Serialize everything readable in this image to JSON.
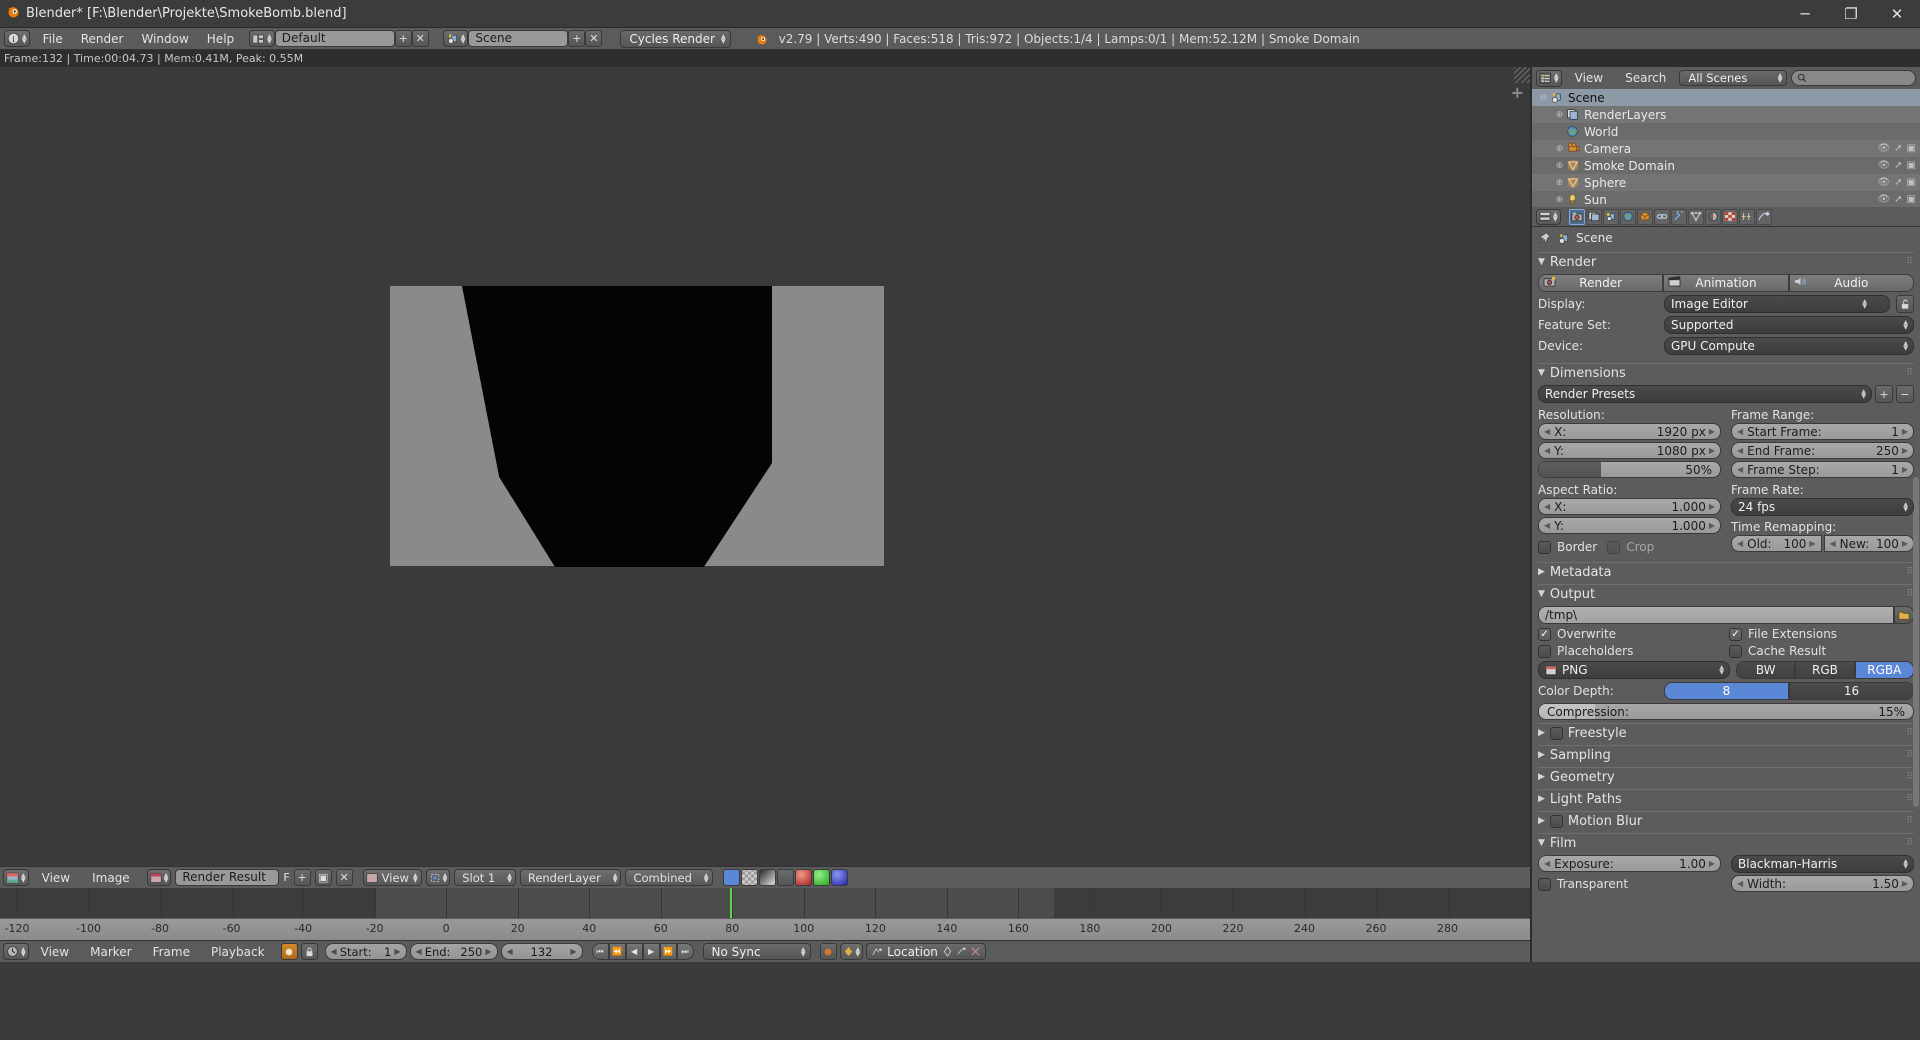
{
  "window": {
    "title": "Blender* [F:\\Blender\\Projekte\\SmokeBomb.blend]",
    "minimize": "─",
    "maximize": "❐",
    "close": "✕"
  },
  "topbar": {
    "menus": [
      "File",
      "Render",
      "Window",
      "Help"
    ],
    "screen_layout": "Default",
    "scene_name": "Scene",
    "engine": "Cycles Render",
    "add_label": "+",
    "remove_label": "✕",
    "stats": "v2.79 | Verts:490 | Faces:518 | Tris:972 | Objects:1/4 | Lamps:0/1 | Mem:52.12M | Smoke Domain"
  },
  "infostrip": {
    "text": "Frame:132 | Time:00:04.73 | Mem:0.41M, Peak: 0.55M"
  },
  "outliner": {
    "header": {
      "view": "View",
      "search": "Search",
      "scene_filter": "All Scenes",
      "search_placeholder": ""
    },
    "rows": [
      {
        "label": "Scene",
        "indent": 0,
        "icon": "scene-icon",
        "expander": "⊖",
        "selected": true
      },
      {
        "label": "RenderLayers",
        "indent": 1,
        "icon": "renderlayers-icon",
        "expander": "⊕",
        "selected": false
      },
      {
        "label": "World",
        "indent": 1,
        "icon": "world-icon",
        "expander": "",
        "selected": false
      },
      {
        "label": "Camera",
        "indent": 1,
        "icon": "camera-icon",
        "expander": "⊕",
        "selected": false
      },
      {
        "label": "Smoke Domain",
        "indent": 1,
        "icon": "mesh-icon",
        "expander": "⊕",
        "selected": false
      },
      {
        "label": "Sphere",
        "indent": 1,
        "icon": "mesh-icon",
        "expander": "⊕",
        "selected": false
      },
      {
        "label": "Sun",
        "indent": 1,
        "icon": "lamp-icon",
        "expander": "⊕",
        "selected": false
      }
    ]
  },
  "properties": {
    "tabs": [
      "render-tab",
      "renderlayers-tab",
      "scene-tab",
      "world-tab",
      "object-tab",
      "constraints-tab",
      "modifiers-tab",
      "data-tab",
      "material-tab",
      "texture-tab",
      "particles-tab",
      "physics-tab"
    ],
    "active_tab_index": 0,
    "breadcrumb": "Scene",
    "render_panel": {
      "title": "Render",
      "buttons": [
        "Render",
        "Animation",
        "Audio"
      ],
      "display_label": "Display:",
      "display_value": "Image Editor",
      "feature_set_label": "Feature Set:",
      "feature_set_value": "Supported",
      "device_label": "Device:",
      "device_value": "GPU Compute"
    },
    "dimensions_panel": {
      "title": "Dimensions",
      "presets": "Render Presets",
      "resolution_label": "Resolution:",
      "res_x_label": "X:",
      "res_x_value": "1920 px",
      "res_y_label": "Y:",
      "res_y_value": "1080 px",
      "res_percent": "50%",
      "res_percent_fill": 34,
      "aspect_label": "Aspect Ratio:",
      "aspect_x_label": "X:",
      "aspect_x_value": "1.000",
      "aspect_y_label": "Y:",
      "aspect_y_value": "1.000",
      "border_label": "Border",
      "border_checked": false,
      "crop_label": "Crop",
      "crop_checked": false,
      "frame_range_label": "Frame Range:",
      "start_frame_label": "Start Frame:",
      "start_frame_value": "1",
      "end_frame_label": "End Frame:",
      "end_frame_value": "250",
      "frame_step_label": "Frame Step:",
      "frame_step_value": "1",
      "frame_rate_label": "Frame Rate:",
      "frame_rate_value": "24 fps",
      "time_remap_label": "Time Remapping:",
      "old_label": "Old:",
      "old_value": "100",
      "new_label": "New:",
      "new_value": "100"
    },
    "metadata_panel": {
      "title": "Metadata"
    },
    "output_panel": {
      "title": "Output",
      "path": "/tmp\\",
      "overwrite_label": "Overwrite",
      "overwrite_checked": true,
      "file_ext_label": "File Extensions",
      "file_ext_checked": true,
      "placeholders_label": "Placeholders",
      "placeholders_checked": false,
      "cache_result_label": "Cache Result",
      "cache_result_checked": false,
      "format": "PNG",
      "color_modes": [
        "BW",
        "RGB",
        "RGBA"
      ],
      "color_mode_active": "RGBA",
      "color_depth_label": "Color Depth:",
      "color_depths": [
        "8",
        "16"
      ],
      "color_depth_active": "8",
      "compression_label": "Compression:",
      "compression_value": "15%",
      "compression_fill": 15
    },
    "collapsed_panels": [
      {
        "title": "Freestyle",
        "has_checkbox": true,
        "checked": false
      },
      {
        "title": "Sampling",
        "has_checkbox": false,
        "checked": false
      },
      {
        "title": "Geometry",
        "has_checkbox": false,
        "checked": false
      },
      {
        "title": "Light Paths",
        "has_checkbox": false,
        "checked": false
      },
      {
        "title": "Motion Blur",
        "has_checkbox": true,
        "checked": false
      }
    ],
    "film_panel": {
      "title": "Film",
      "exposure_label": "Exposure:",
      "exposure_value": "1.00",
      "transparent_label": "Transparent",
      "transparent_checked": false,
      "filter_type": "Blackman-Harris",
      "width_label": "Width:",
      "width_value": "1.50"
    }
  },
  "image_editor_bar": {
    "view_menu": "View",
    "image_menu": "Image",
    "image_name": "Render Result",
    "fake_user": "F",
    "add": "+",
    "new": "▣",
    "unlink": "✕",
    "view_dropdown": "View",
    "slot": "Slot 1",
    "layer": "RenderLayer",
    "pass": "Combined"
  },
  "timeline": {
    "ruler_ticks": [
      "-120",
      "-100",
      "-80",
      "-60",
      "-40",
      "-20",
      "0",
      "20",
      "40",
      "60",
      "80",
      "100",
      "120",
      "140",
      "160",
      "180",
      "200",
      "220",
      "240",
      "260",
      "280"
    ],
    "playhead_frame": 132,
    "view_menu": "View",
    "marker_menu": "Marker",
    "frame_menu": "Frame",
    "playback_menu": "Playback",
    "start_label": "Start:",
    "start_value": "1",
    "end_label": "End:",
    "end_value": "250",
    "current_frame": "132",
    "sync_mode": "No Sync",
    "keying_set": "Location"
  },
  "colors": {
    "accent_blue": "#5a87d6",
    "playhead_green": "#5bd94a",
    "header_gray": "#5b5b5b",
    "panel_gray": "#5c5c5c",
    "viewport_gray": "#3a3a3a"
  }
}
